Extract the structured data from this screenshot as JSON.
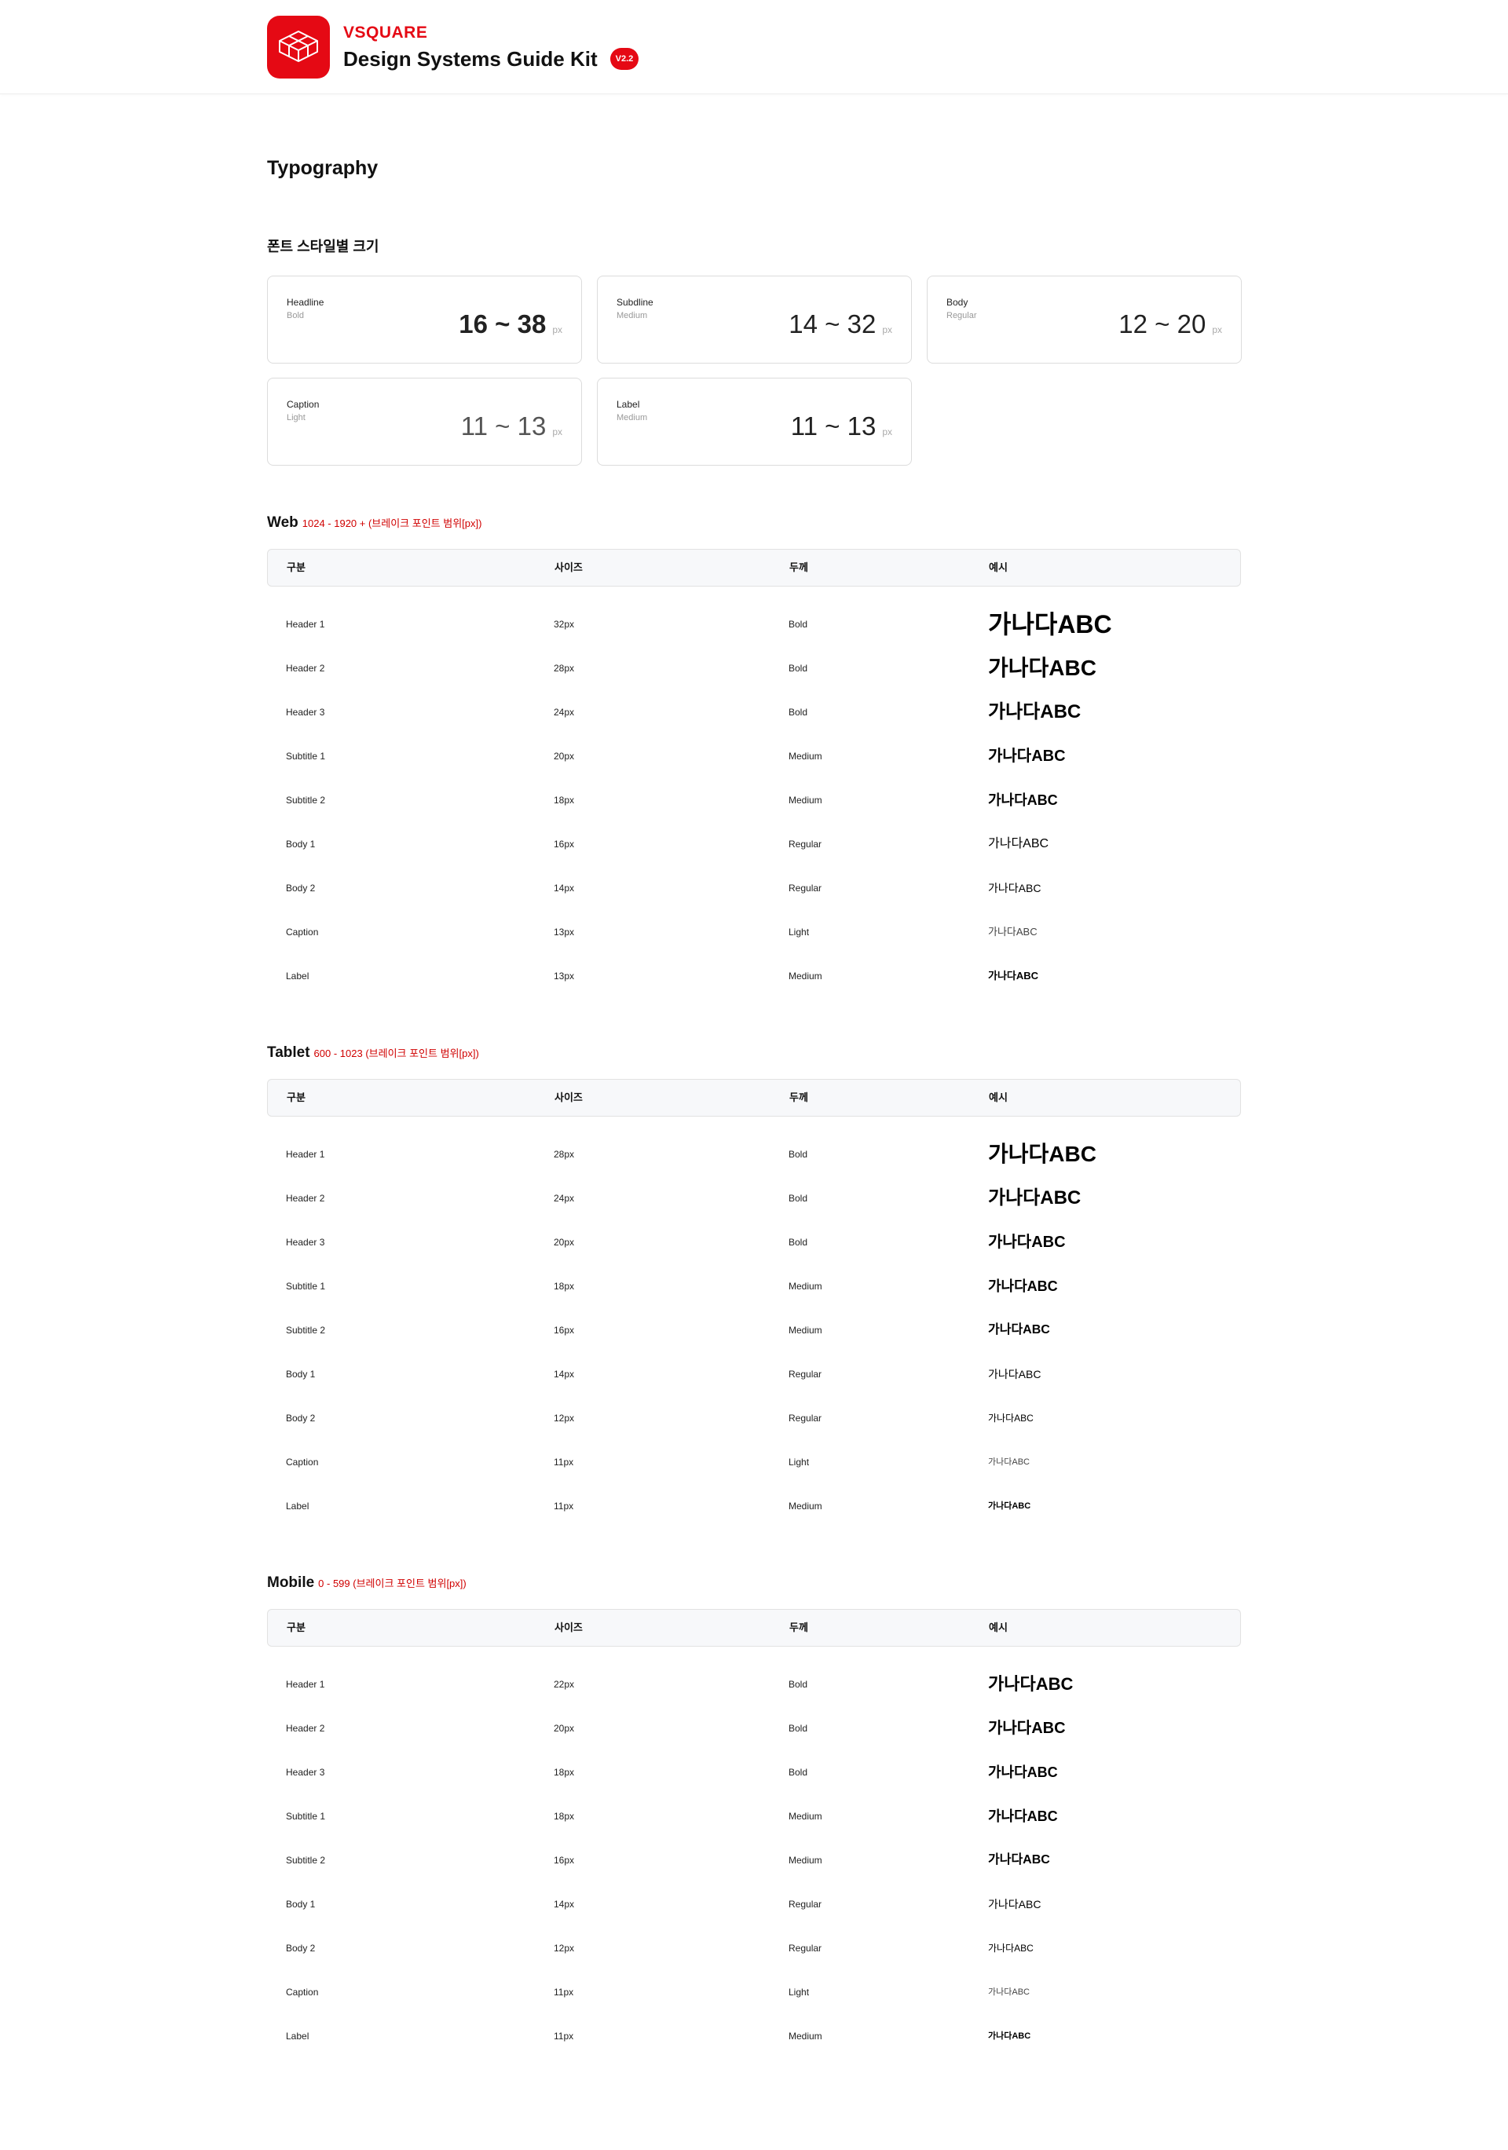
{
  "brand": {
    "name": "VSQUARE",
    "title": "Design Systems Guide Kit",
    "version": "V2.2",
    "accent": "#e50914"
  },
  "page_title": "Typography",
  "font_styles": {
    "title": "폰트 스타일별 크기",
    "unit": "px",
    "cards": [
      {
        "name": "Headline",
        "weight": "Bold",
        "range": "16 ~ 38"
      },
      {
        "name": "Subdline",
        "weight": "Medium",
        "range": "14 ~ 32"
      },
      {
        "name": "Body",
        "weight": "Regular",
        "range": "12 ~ 20"
      },
      {
        "name": "Caption",
        "weight": "Light",
        "range": "11 ~ 13"
      },
      {
        "name": "Label",
        "weight": "Medium",
        "range": "11 ~ 13"
      }
    ]
  },
  "columns": [
    "구분",
    "사이즈",
    "두께",
    "예시"
  ],
  "sample_text": "가나다ABC",
  "sections": [
    {
      "name": "Web",
      "range": "1024 - 1920 + (브레이크 포인트 범위[px])",
      "rows": [
        {
          "style": "Header 1",
          "size": "32px",
          "weight": "Bold"
        },
        {
          "style": "Header 2",
          "size": "28px",
          "weight": "Bold"
        },
        {
          "style": "Header 3",
          "size": "24px",
          "weight": "Bold"
        },
        {
          "style": "Subtitle 1",
          "size": "20px",
          "weight": "Medium"
        },
        {
          "style": "Subtitle 2",
          "size": "18px",
          "weight": "Medium"
        },
        {
          "style": "Body 1",
          "size": "16px",
          "weight": "Regular"
        },
        {
          "style": "Body 2",
          "size": "14px",
          "weight": "Regular"
        },
        {
          "style": "Caption",
          "size": "13px",
          "weight": "Light"
        },
        {
          "style": "Label",
          "size": "13px",
          "weight": "Medium"
        }
      ]
    },
    {
      "name": "Tablet",
      "range": "600 - 1023 (브레이크 포인트 범위[px])",
      "rows": [
        {
          "style": "Header 1",
          "size": "28px",
          "weight": "Bold"
        },
        {
          "style": "Header 2",
          "size": "24px",
          "weight": "Bold"
        },
        {
          "style": "Header 3",
          "size": "20px",
          "weight": "Bold"
        },
        {
          "style": "Subtitle 1",
          "size": "18px",
          "weight": "Medium"
        },
        {
          "style": "Subtitle 2",
          "size": "16px",
          "weight": "Medium"
        },
        {
          "style": "Body 1",
          "size": "14px",
          "weight": "Regular"
        },
        {
          "style": "Body 2",
          "size": "12px",
          "weight": "Regular"
        },
        {
          "style": "Caption",
          "size": "11px",
          "weight": "Light"
        },
        {
          "style": "Label",
          "size": "11px",
          "weight": "Medium"
        }
      ]
    },
    {
      "name": "Mobile",
      "range": "0 - 599 (브레이크 포인트 범위[px])",
      "rows": [
        {
          "style": "Header 1",
          "size": "22px",
          "weight": "Bold"
        },
        {
          "style": "Header 2",
          "size": "20px",
          "weight": "Bold"
        },
        {
          "style": "Header 3",
          "size": "18px",
          "weight": "Bold"
        },
        {
          "style": "Subtitle 1",
          "size": "18px",
          "weight": "Medium"
        },
        {
          "style": "Subtitle 2",
          "size": "16px",
          "weight": "Medium"
        },
        {
          "style": "Body 1",
          "size": "14px",
          "weight": "Regular"
        },
        {
          "style": "Body 2",
          "size": "12px",
          "weight": "Regular"
        },
        {
          "style": "Caption",
          "size": "11px",
          "weight": "Light"
        },
        {
          "style": "Label",
          "size": "11px",
          "weight": "Medium"
        }
      ]
    }
  ]
}
